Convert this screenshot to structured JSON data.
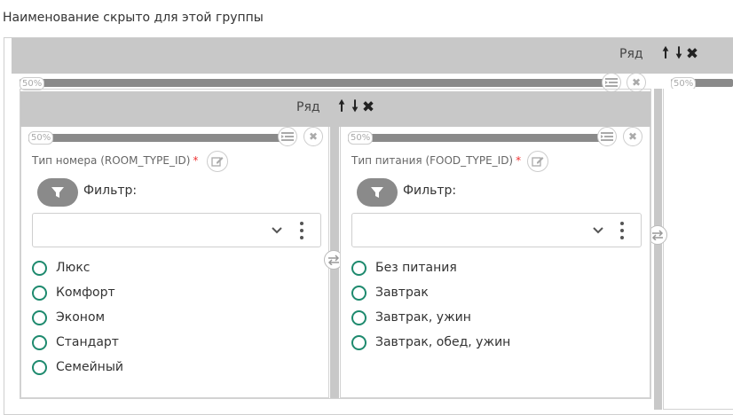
{
  "group": {
    "title": "Наименование скрыто для этой группы"
  },
  "outer_row": {
    "label": "Ряд",
    "cell1_pct": "50%",
    "cell2_pct": "50%"
  },
  "inner_row": {
    "label": "Ряд"
  },
  "columns": [
    {
      "pct": "50%",
      "field_label": "Тип номера (ROOM_TYPE_ID)",
      "required_mark": "*",
      "filter_label": "Фильтр:",
      "select_value": "",
      "options": [
        "Люкс",
        "Комфорт",
        "Эконом",
        "Стандарт",
        "Семейный"
      ]
    },
    {
      "pct": "50%",
      "field_label": "Тип питания (FOOD_TYPE_ID)",
      "required_mark": "*",
      "filter_label": "Фильтр:",
      "select_value": "",
      "options": [
        "Без питания",
        "Завтрак",
        "Завтрак, ужин",
        "Завтрак, обед, ужин"
      ]
    }
  ],
  "icons": {
    "move_up": "arrow-up-icon",
    "move_down": "arrow-down-icon",
    "remove": "close-icon",
    "settings": "list-settings-icon",
    "edit": "edit-icon",
    "filter": "filter-icon",
    "dropdown": "chevron-down-icon",
    "more": "more-vertical-icon",
    "swap": "swap-icon"
  },
  "colors": {
    "radio_accent": "#1e8a6e",
    "row_header_bg": "#c8c8c8",
    "bar": "#8a8a8a",
    "required": "#ee3333"
  }
}
